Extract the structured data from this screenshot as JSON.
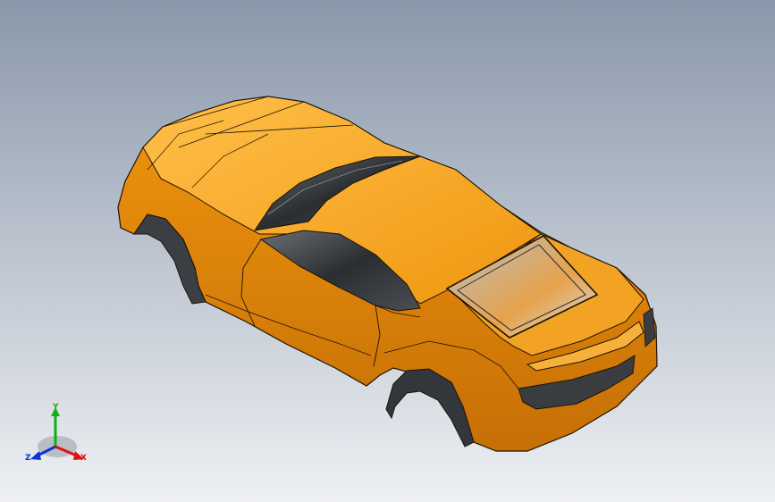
{
  "viewport": {
    "background_top": "#8a98ab",
    "background_bottom": "#eef0f3"
  },
  "model": {
    "body_color": "#f0960f",
    "body_shadow": "#c66f05",
    "body_highlight": "#ffc04a",
    "glass_color": "#2e3133",
    "edge_color": "#1c1208"
  },
  "triad": {
    "x_label": "X",
    "y_label": "Y",
    "z_label": "Z",
    "x_color": "#e01010",
    "y_color": "#10b010",
    "z_color": "#1030d0"
  }
}
